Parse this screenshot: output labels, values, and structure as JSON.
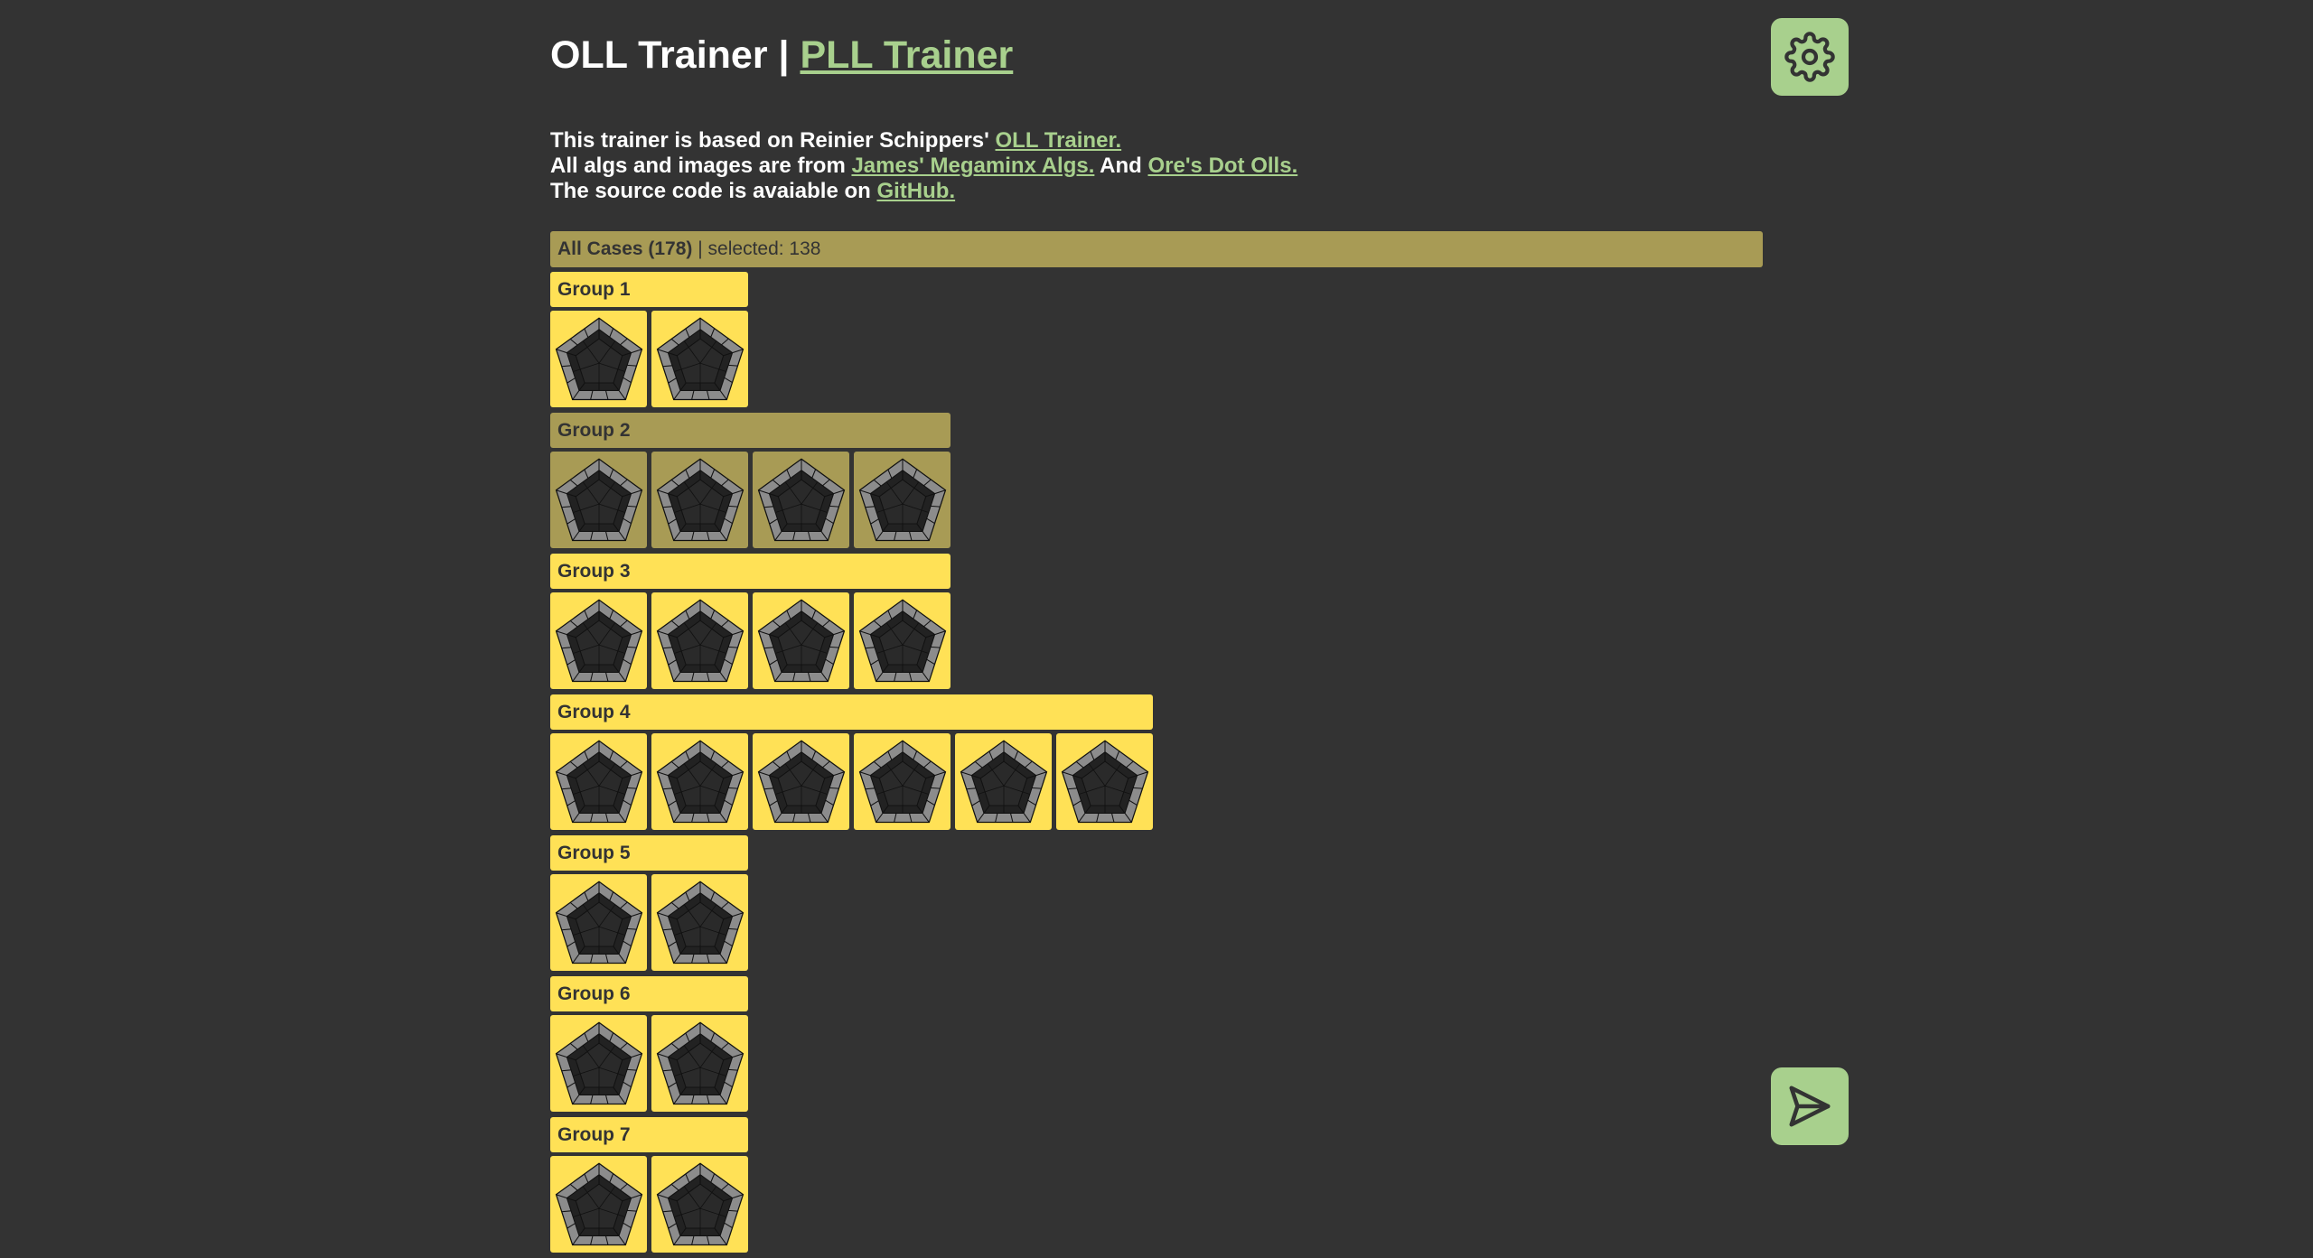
{
  "header": {
    "title_prefix": "OLL Trainer | ",
    "pll_link": "PLL Trainer"
  },
  "intro": {
    "line1_text": "This trainer is based on Reinier Schippers' ",
    "line1_link": "OLL Trainer.",
    "line2_text": "All algs and images are from ",
    "line2_link1": "James' Megaminx Algs.",
    "line2_mid": " And ",
    "line2_link2": "Ore's Dot Olls.",
    "line3_text": "The source code is avaiable on ",
    "line3_link": "GitHub."
  },
  "all_cases": {
    "label": "All Cases (178)",
    "selected_text": " | selected: 138"
  },
  "groups": [
    {
      "name": "Group 1",
      "count": 2,
      "selected": true
    },
    {
      "name": "Group 2",
      "count": 4,
      "selected": false
    },
    {
      "name": "Group 3",
      "count": 4,
      "selected": true
    },
    {
      "name": "Group 4",
      "count": 6,
      "selected": true
    },
    {
      "name": "Group 5",
      "count": 2,
      "selected": true
    },
    {
      "name": "Group 6",
      "count": 2,
      "selected": true
    },
    {
      "name": "Group 7",
      "count": 2,
      "selected": true
    }
  ],
  "icons": {
    "settings": "gear-icon",
    "send": "send-icon",
    "case": "megaminx-pentagon-icon"
  },
  "colors": {
    "background": "#333333",
    "selected": "#ffe156",
    "unselected": "#a89b55",
    "accent": "#a8d08d"
  }
}
